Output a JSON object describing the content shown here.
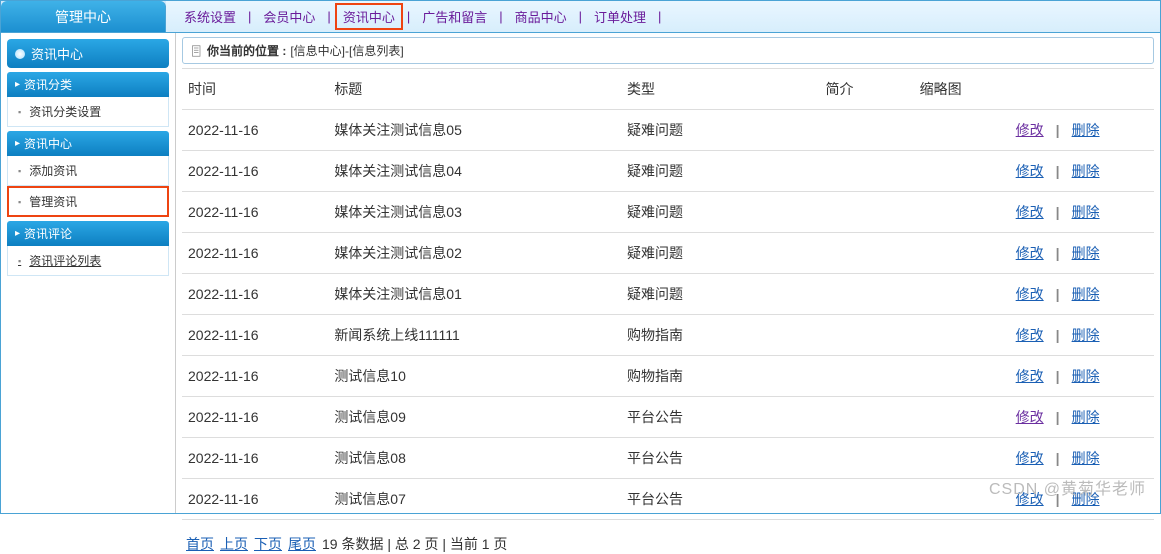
{
  "brand": "管理中心",
  "top_tabs": [
    "系统设置",
    "会员中心",
    "资讯中心",
    "广告和留言",
    "商品中心",
    "订单处理"
  ],
  "top_tab_highlight_index": 2,
  "sidebar": {
    "title": "资讯中心",
    "groups": [
      {
        "title": "资讯分类",
        "items": [
          {
            "label": "资讯分类设置",
            "active": false
          }
        ]
      },
      {
        "title": "资讯中心",
        "items": [
          {
            "label": "添加资讯",
            "active": false
          },
          {
            "label": "管理资讯",
            "active": true
          }
        ]
      },
      {
        "title": "资讯评论",
        "items": [
          {
            "label": "资讯评论列表",
            "active": false,
            "underlined": true
          }
        ]
      }
    ]
  },
  "breadcrumb": {
    "prefix": "你当前的位置 :",
    "path": "[信息中心]-[信息列表]"
  },
  "table": {
    "columns": [
      "时间",
      "标题",
      "类型",
      "简介",
      "缩略图",
      ""
    ],
    "rows": [
      {
        "time": "2022-11-16",
        "title": "媒体关注测试信息05",
        "type": "疑难问题",
        "intro": "",
        "thumb": "",
        "edit_visited": true
      },
      {
        "time": "2022-11-16",
        "title": "媒体关注测试信息04",
        "type": "疑难问题",
        "intro": "",
        "thumb": "",
        "edit_visited": false
      },
      {
        "time": "2022-11-16",
        "title": "媒体关注测试信息03",
        "type": "疑难问题",
        "intro": "",
        "thumb": "",
        "edit_visited": false
      },
      {
        "time": "2022-11-16",
        "title": "媒体关注测试信息02",
        "type": "疑难问题",
        "intro": "",
        "thumb": "",
        "edit_visited": false
      },
      {
        "time": "2022-11-16",
        "title": "媒体关注测试信息01",
        "type": "疑难问题",
        "intro": "",
        "thumb": "",
        "edit_visited": false
      },
      {
        "time": "2022-11-16",
        "title": "新闻系统上线111111",
        "type": "购物指南",
        "intro": "",
        "thumb": "",
        "edit_visited": false
      },
      {
        "time": "2022-11-16",
        "title": "测试信息10",
        "type": "购物指南",
        "intro": "",
        "thumb": "",
        "edit_visited": false
      },
      {
        "time": "2022-11-16",
        "title": "测试信息09",
        "type": "平台公告",
        "intro": "",
        "thumb": "",
        "edit_visited": true
      },
      {
        "time": "2022-11-16",
        "title": "测试信息08",
        "type": "平台公告",
        "intro": "",
        "thumb": "",
        "edit_visited": false
      },
      {
        "time": "2022-11-16",
        "title": "测试信息07",
        "type": "平台公告",
        "intro": "",
        "thumb": "",
        "edit_visited": false
      }
    ],
    "action_edit": "修改",
    "action_delete": "删除"
  },
  "pager": {
    "first": "首页",
    "prev": "上页",
    "next": "下页",
    "last": "尾页",
    "summary": "19 条数据 | 总 2 页 | 当前 1 页"
  },
  "watermark": "CSDN @黄菊华老师"
}
